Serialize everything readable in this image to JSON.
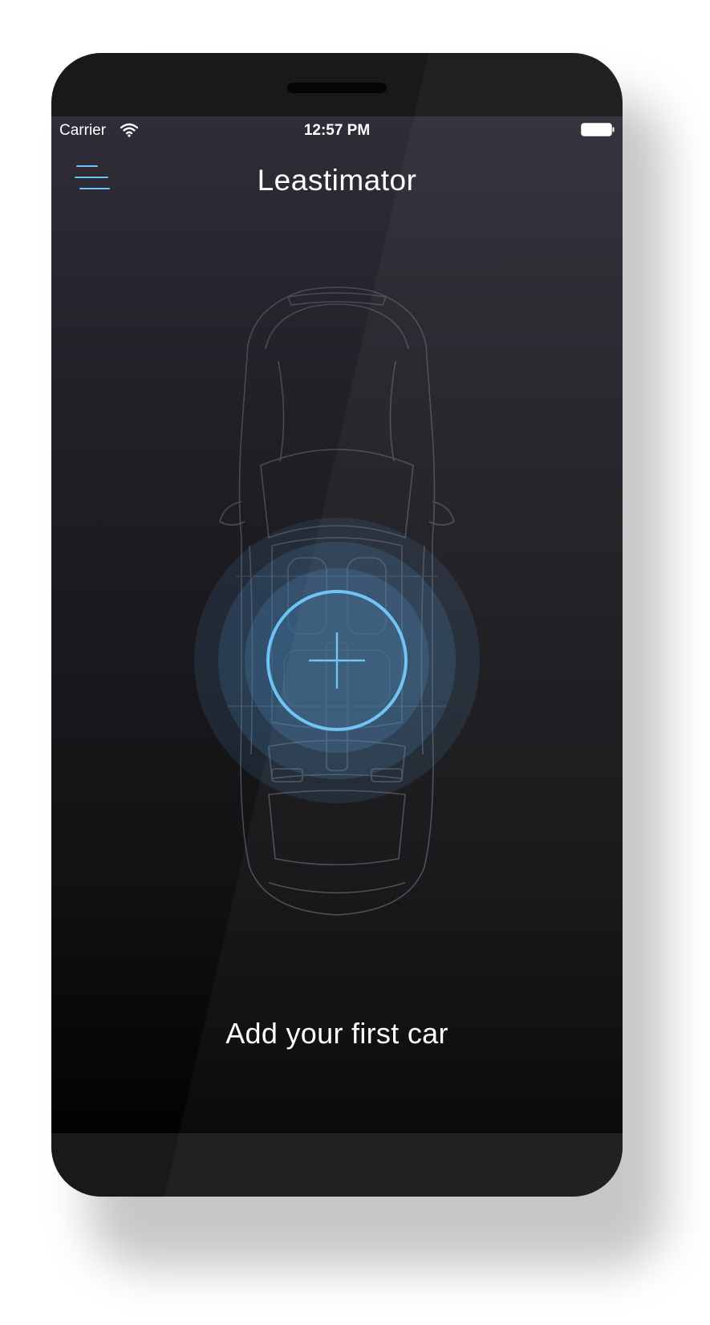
{
  "status_bar": {
    "carrier": "Carrier",
    "time": "12:57 PM",
    "wifi_icon": "wifi-icon",
    "battery_icon": "battery-full-icon"
  },
  "nav": {
    "title": "Leastimator",
    "menu_icon": "hamburger-menu-icon"
  },
  "hero": {
    "illustration": "car-top-view-outline",
    "add_icon": "plus-icon",
    "cta_label": "Add your first car"
  },
  "colors": {
    "accent": "#6cc3f5",
    "background_top": "#302d38",
    "background_bottom": "#020202",
    "text": "#ffffff"
  }
}
